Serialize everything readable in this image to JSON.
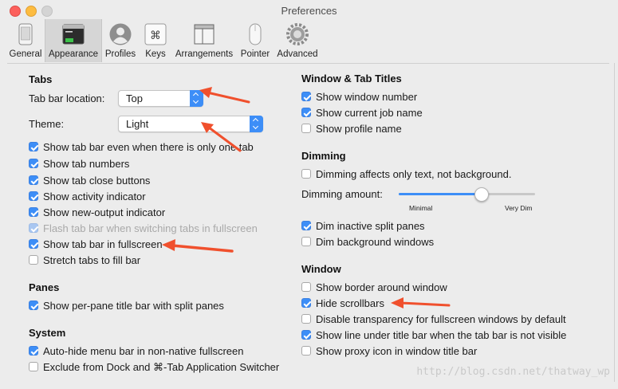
{
  "window": {
    "title": "Preferences"
  },
  "toolbar": {
    "items": [
      {
        "label": "General",
        "icon": "phone-icon"
      },
      {
        "label": "Appearance",
        "icon": "terminal-window-icon",
        "active": true
      },
      {
        "label": "Profiles",
        "icon": "user-silhouette-icon"
      },
      {
        "label": "Keys",
        "icon": "command-key-icon"
      },
      {
        "label": "Arrangements",
        "icon": "window-stack-icon"
      },
      {
        "label": "Pointer",
        "icon": "mouse-icon"
      },
      {
        "label": "Advanced",
        "icon": "gear-icon"
      }
    ]
  },
  "tabs": {
    "heading": "Tabs",
    "location_label": "Tab bar location:",
    "location_value": "Top",
    "theme_label": "Theme:",
    "theme_value": "Light",
    "options": [
      {
        "label": "Show tab bar even when there is only one tab",
        "checked": true
      },
      {
        "label": "Show tab numbers",
        "checked": true
      },
      {
        "label": "Show tab close buttons",
        "checked": true
      },
      {
        "label": "Show activity indicator",
        "checked": true
      },
      {
        "label": "Show new-output indicator",
        "checked": true
      },
      {
        "label": "Flash tab bar when switching tabs in fullscreen",
        "checked": true,
        "disabled": true
      },
      {
        "label": "Show tab bar in fullscreen",
        "checked": true
      },
      {
        "label": "Stretch tabs to fill bar",
        "checked": false
      }
    ]
  },
  "panes": {
    "heading": "Panes",
    "options": [
      {
        "label": "Show per-pane title bar with split panes",
        "checked": true
      }
    ]
  },
  "system": {
    "heading": "System",
    "options": [
      {
        "label": "Auto-hide menu bar in non-native fullscreen",
        "checked": true
      },
      {
        "label": "Exclude from Dock and ⌘-Tab Application Switcher",
        "checked": false
      }
    ]
  },
  "window_tab_titles": {
    "heading": "Window & Tab Titles",
    "options": [
      {
        "label": "Show window number",
        "checked": true
      },
      {
        "label": "Show current job name",
        "checked": true
      },
      {
        "label": "Show profile name",
        "checked": false
      }
    ]
  },
  "dimming": {
    "heading": "Dimming",
    "only_text": {
      "label": "Dimming affects only text, not background.",
      "checked": false
    },
    "amount_label": "Dimming amount:",
    "amount_fraction": 0.6,
    "min_label": "Minimal",
    "max_label": "Very Dim",
    "options": [
      {
        "label": "Dim inactive split panes",
        "checked": true
      },
      {
        "label": "Dim background windows",
        "checked": false
      }
    ]
  },
  "window_section": {
    "heading": "Window",
    "options": [
      {
        "label": "Show border around window",
        "checked": false
      },
      {
        "label": "Hide scrollbars",
        "checked": true
      },
      {
        "label": "Disable transparency for fullscreen windows by default",
        "checked": false
      },
      {
        "label": "Show line under title bar when the tab bar is not visible",
        "checked": true
      },
      {
        "label": "Show proxy icon in window title bar",
        "checked": false
      }
    ]
  },
  "watermark": "http://blog.csdn.net/thatway_wp",
  "colors": {
    "accent": "#3d8ef7",
    "annotation_arrow": "#f0502d"
  }
}
